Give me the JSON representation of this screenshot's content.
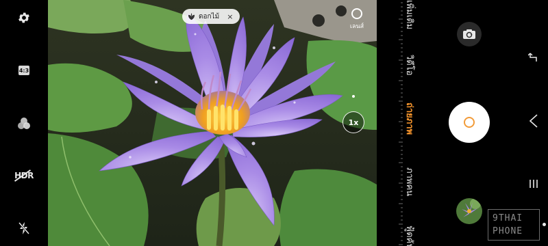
{
  "left_toolbar": {
    "settings_icon": "gear-icon",
    "aspect_ratio_label": "4:3",
    "filter_icon": "filter-circles-icon",
    "hdr_label": "HDR",
    "flash_icon": "flash-off-icon"
  },
  "viewfinder": {
    "scene_chip_label": "ดอกไม้",
    "scene_chip_close": "×",
    "lens_label": "เลนส์",
    "zoom_label": "1x"
  },
  "modes": [
    {
      "label": "เพิ่มเติม"
    },
    {
      "label": "วิดีโอ"
    },
    {
      "label": "ถ่ายภาพ"
    },
    {
      "label": "ภาพคน"
    },
    {
      "label": "ฟู้ดคัน"
    }
  ],
  "active_mode": "ถ่ายภาพ",
  "right_controls": {
    "switch_camera_icon": "camera-flip-icon",
    "gallery_icon": "gallery-thumbnail"
  },
  "nav": {
    "back_icon": "back-icon",
    "home_icon": "home-icon",
    "recents_icon": "recents-icon"
  },
  "watermark": {
    "line1": "9THAI",
    "line2": "PHONE"
  },
  "colors": {
    "accent": "#ff9a2e",
    "petal": "#a98be6",
    "leaf": "#4f8a3a",
    "background": "#000000"
  }
}
